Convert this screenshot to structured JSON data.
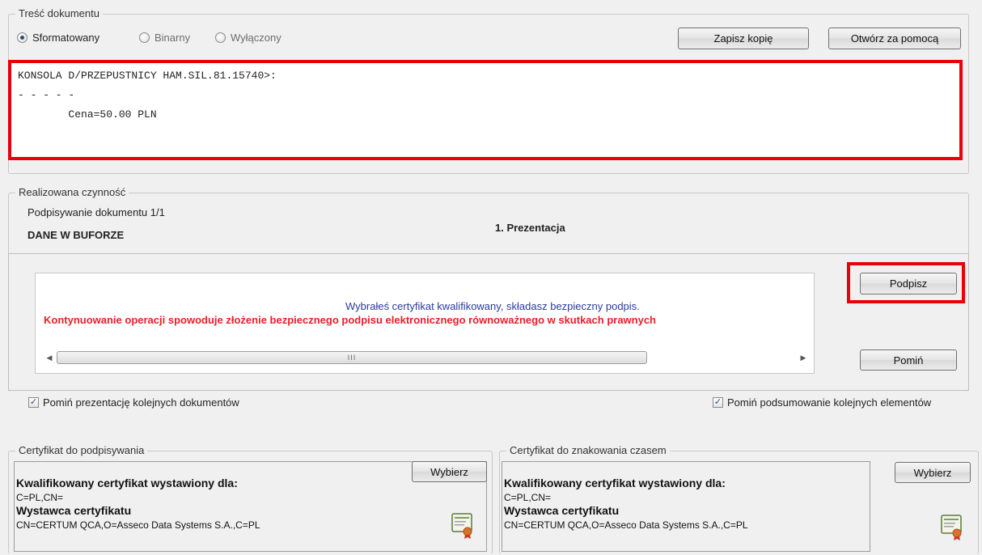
{
  "content_group": {
    "legend": "Treść dokumentu",
    "radios": [
      {
        "label": "Sformatowany",
        "checked": true
      },
      {
        "label": "Binarny",
        "checked": false
      },
      {
        "label": "Wyłączony",
        "checked": false
      }
    ],
    "save_copy_label": "Zapisz kopię",
    "open_with_label": "Otwórz za pomocą",
    "document_lines": [
      "KONSOLA D/PRZEPUSTNICY HAM.SIL.81.15740>:",
      "- - - - -",
      "        Cena=50.00 PLN"
    ]
  },
  "activity_group": {
    "legend": "Realizowana czynność",
    "progress_label": "Podpisywanie dokumentu 1/1",
    "buffer_label": "DANE W BUFORZE",
    "step_label": "1. Prezentacja",
    "info_line": "Wybrałeś certyfikat kwalifikowany, składasz bezpieczny podpis.",
    "warning_line": "Kontynuowanie operacji spowoduje złożenie bezpiecznego podpisu elektronicznego równoważnego w skutkach prawnych",
    "sign_label": "Podpisz",
    "skip_label": "Pomiń",
    "scroll_thumb_grip": "III"
  },
  "options": {
    "skip_presentation": {
      "label": "Pomiń prezentację kolejnych dokumentów",
      "checked": true
    },
    "skip_summary": {
      "label": "Pomiń podsumowanie kolejnych elementów",
      "checked": true
    }
  },
  "signing_cert": {
    "legend": "Certyfikat do podpisywania",
    "title": "Kwalifikowany certyfikat wystawiony dla:",
    "subject": "C=PL,CN=",
    "issuer_title": "Wystawca certyfikatu",
    "issuer": "CN=CERTUM QCA,O=Asseco Data Systems S.A.,C=PL",
    "choose_label": "Wybierz"
  },
  "timestamp_cert": {
    "legend": "Certyfikat do znakowania czasem",
    "title": "Kwalifikowany certyfikat wystawiony dla:",
    "subject": "C=PL,CN=",
    "issuer_title": "Wystawca certyfikatu",
    "issuer": "CN=CERTUM QCA,O=Asseco Data Systems S.A.,C=PL",
    "choose_label": "Wybierz"
  },
  "colors": {
    "highlight": "#e8000b",
    "info_text": "#2b3c9a",
    "warning_text": "#e8202a"
  },
  "icons": {
    "certificate": "certificate-icon"
  }
}
